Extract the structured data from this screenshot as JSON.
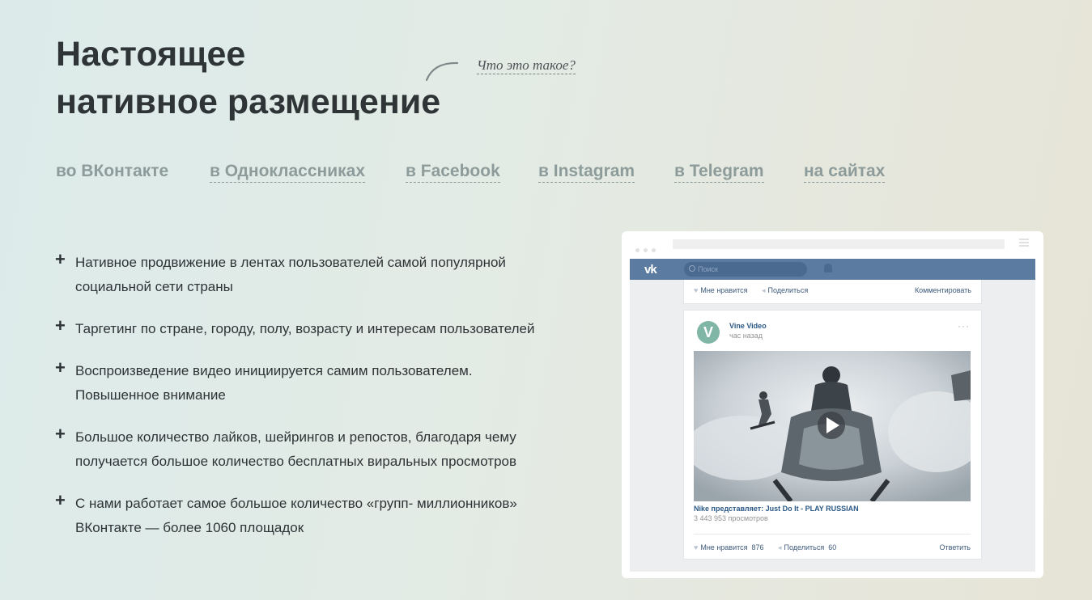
{
  "heading": {
    "line1": "Настоящее",
    "line2": "нативное размещение",
    "what_link": "Что это такое?"
  },
  "tabs": [
    {
      "label": "во ВКонтакте",
      "active": true
    },
    {
      "label": "в Одноклассниках",
      "active": false
    },
    {
      "label": "в Facebook",
      "active": false
    },
    {
      "label": "в Instagram",
      "active": false
    },
    {
      "label": "в Telegram",
      "active": false
    },
    {
      "label": "на сайтах",
      "active": false
    }
  ],
  "features": [
    {
      "lines": [
        "Нативное продвижение в лентах пользователей самой популярной",
        "социальной сети страны"
      ]
    },
    {
      "lines": [
        "Таргетинг по стране, городу, полу, возрасту и интересам пользователей"
      ]
    },
    {
      "lines": [
        "Воспроизведение видео инициируется самим пользователем.",
        "Повышенное внимание"
      ]
    },
    {
      "lines": [
        "Большое количество лайков, шейрингов и репостов, благодаря чему",
        "получается большое количество бесплатных виральных просмотров"
      ]
    },
    {
      "lines": [
        "С нами работает самое большое количество «групп- миллионников»",
        "ВКонтакте — более 1060 площадок"
      ]
    }
  ],
  "mock": {
    "vk_logo": "vk",
    "search_placeholder": "Поиск",
    "top_card": {
      "like": "Мне нравится",
      "share": "Поделиться",
      "comment": "Комментировать"
    },
    "post": {
      "author": "Vine Video",
      "avatar_letter": "V",
      "time": "час назад",
      "more": "···",
      "video_title": "Nike представляет: Just Do It - PLAY RUSSIAN",
      "views": "3 443 953 просмотров",
      "like": "Мне нравится",
      "like_count": "876",
      "share": "Поделиться",
      "share_count": "60",
      "reply": "Ответить"
    }
  },
  "colors": {
    "title": "#2f3437",
    "tab": "#8d9c9a",
    "vk_blue": "#5b7ba0",
    "vk_link": "#2a5885"
  }
}
